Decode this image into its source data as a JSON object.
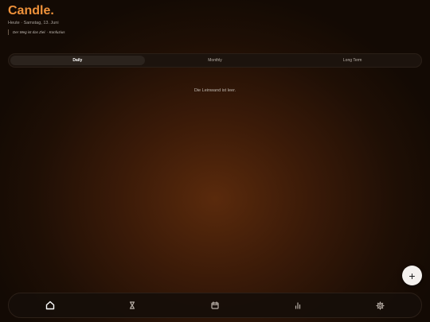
{
  "header": {
    "app_title": "Candle.",
    "date_line": "Heute · Samstag, 13. Juni",
    "quote": "Der Weg ist das Ziel. - Konfuzius"
  },
  "tabs": [
    {
      "label": "Daily",
      "active": true
    },
    {
      "label": "Monthly",
      "active": false
    },
    {
      "label": "Long Term",
      "active": false
    }
  ],
  "canvas": {
    "empty_message": "Die Leinwand ist leer."
  },
  "fab": {
    "icon": "plus-icon",
    "label": "+"
  },
  "bottom_nav": [
    {
      "icon": "home-icon",
      "active": true
    },
    {
      "icon": "hourglass-icon",
      "active": false
    },
    {
      "icon": "calendar-icon",
      "active": false
    },
    {
      "icon": "bar-chart-icon",
      "active": false
    },
    {
      "icon": "gear-icon",
      "active": false
    }
  ],
  "colors": {
    "accent": "#f0923a",
    "background_center": "#5a2a0c",
    "background_edge": "#130a04"
  }
}
